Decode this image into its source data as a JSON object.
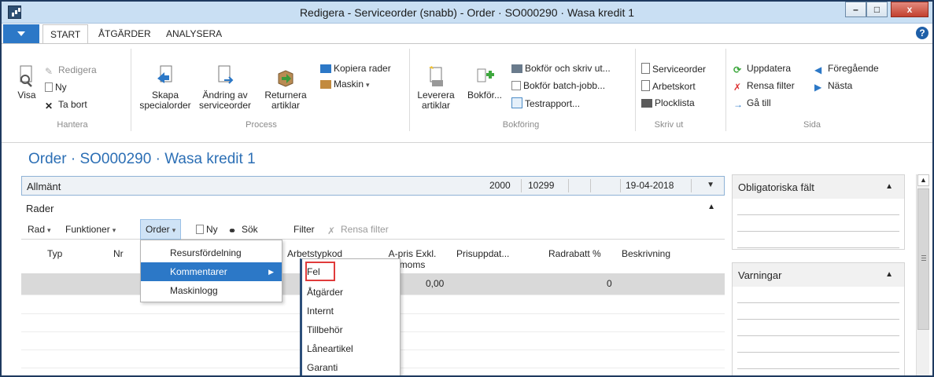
{
  "window": {
    "title": "Redigera - Serviceorder (snabb) - Order · SO000290 · Wasa kredit 1",
    "min": "–",
    "max": "□",
    "close": "x"
  },
  "ribbon": {
    "tabs": [
      "START",
      "ÅTGÄRDER",
      "ANALYSERA"
    ],
    "help": "?",
    "groups": {
      "hantera": {
        "label": "Hantera",
        "visa": "Visa",
        "redigera": "Redigera",
        "ny": "Ny",
        "ta_bort": "Ta bort"
      },
      "process": {
        "label": "Process",
        "skapa": [
          "Skapa",
          "specialorder"
        ],
        "andring": [
          "Ändring av",
          "serviceorder"
        ],
        "returnera": [
          "Returnera",
          "artiklar"
        ],
        "kopiera": "Kopiera rader",
        "maskin": "Maskin"
      },
      "bokforing": {
        "label": "Bokföring",
        "leverera": [
          "Leverera",
          "artiklar"
        ],
        "bokfor": "Bokför...",
        "skriv_ut": "Bokför och skriv ut...",
        "batch": "Bokför batch-jobb...",
        "testrapport": "Testrapport..."
      },
      "skriv_ut": {
        "label": "Skriv ut",
        "serviceorder": "Serviceorder",
        "arbetskort": "Arbetskort",
        "plocklista": "Plocklista"
      },
      "sida": {
        "label": "Sida",
        "uppdatera": "Uppdatera",
        "rensa_filter": "Rensa filter",
        "ga_till": "Gå till",
        "foregaende": "Föregående",
        "nasta": "Nästa"
      }
    }
  },
  "page": {
    "title": "Order · SO000290 · Wasa kredit 1",
    "general": {
      "label": "Allmänt",
      "summary": [
        "2000",
        "10299",
        "",
        "19-04-2018"
      ]
    },
    "lines": {
      "label": "Rader",
      "actions": {
        "rad": "Rad",
        "funktioner": "Funktioner",
        "order": "Order",
        "ny": "Ny",
        "sok": "Sök",
        "filter": "Filter",
        "rensa_filter": "Rensa filter"
      },
      "columns": {
        "typ": "Typ",
        "nr": "Nr",
        "arbetstypkod": "Arbetstypkod",
        "apris": [
          "A-pris Exkl.",
          "moms"
        ],
        "prisuppdat": "Prisuppdat...",
        "radrabatt": "Radrabatt %",
        "beskrivning": "Beskrivning"
      },
      "row": {
        "apris": "0,00",
        "radrabatt": "0"
      }
    },
    "order_menu": [
      "Resursfördelning",
      "Kommentarer",
      "Maskinlogg"
    ],
    "comment_submenu": [
      "Fel",
      "Åtgärder",
      "Internt",
      "Tillbehör",
      "Låneartikel",
      "Garanti"
    ]
  },
  "factboxes": {
    "obligatoriska": "Obligatoriska fält",
    "varningar": "Varningar"
  }
}
